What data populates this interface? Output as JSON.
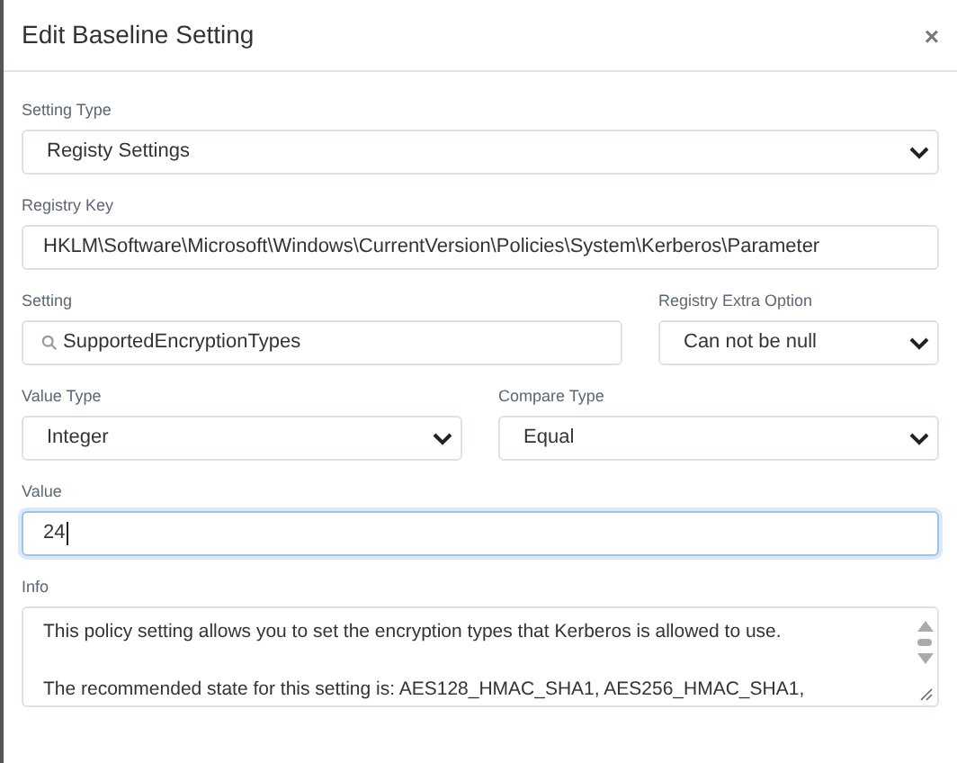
{
  "dialog": {
    "title": "Edit Baseline Setting",
    "close": "×"
  },
  "rows": [
    [
      {
        "kind": "select",
        "label": "Setting Type",
        "value": "Registy Settings",
        "focused": false
      }
    ],
    [
      {
        "kind": "text",
        "label": "Registry Key",
        "value": "HKLM\\Software\\Microsoft\\Windows\\CurrentVersion\\Policies\\System\\Kerberos\\Parameter",
        "focused": false
      }
    ],
    [
      {
        "kind": "search",
        "label": "Setting",
        "value": "SupportedEncryptionTypes",
        "focused": false
      },
      {
        "kind": "select",
        "label": "Registry Extra Option",
        "value": "Can not be null",
        "focused": false
      }
    ],
    [
      {
        "kind": "select",
        "label": "Value Type",
        "value": "Integer",
        "focused": false
      },
      {
        "kind": "select",
        "label": "Compare Type",
        "value": "Equal",
        "focused": false
      }
    ],
    [
      {
        "kind": "text",
        "label": "Value",
        "value": "24",
        "focused": true
      }
    ],
    [
      {
        "kind": "textarea",
        "label": "Info",
        "paragraphs": [
          "This policy setting allows you to set the encryption types that Kerberos is allowed to use.",
          "The recommended state for this setting is: AES128_HMAC_SHA1, AES256_HMAC_SHA1,"
        ],
        "focused": false
      }
    ]
  ]
}
